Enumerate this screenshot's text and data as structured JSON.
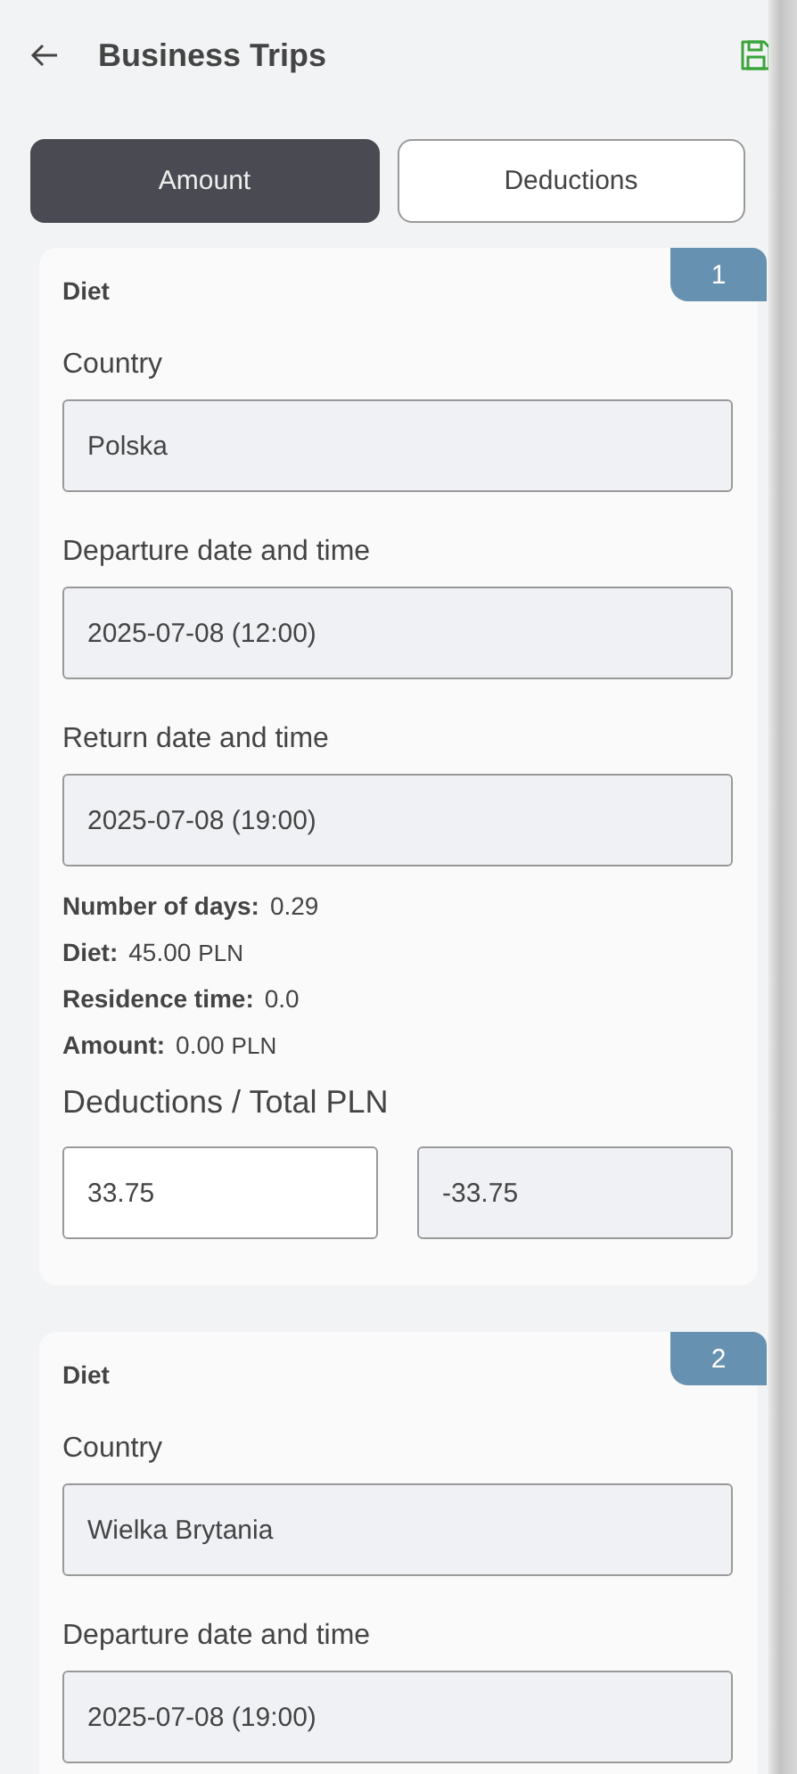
{
  "header": {
    "title": "Business Trips"
  },
  "tabs": [
    {
      "label": "Amount",
      "selected": true
    },
    {
      "label": "Deductions",
      "selected": false
    }
  ],
  "trips": [
    {
      "number": "1",
      "type": "Diet",
      "fields": [
        {
          "label": "Country",
          "value": "Polska"
        },
        {
          "label": "Departure date and time",
          "value": "2025-07-08 (12:00)"
        },
        {
          "label": "Return date and time",
          "value": "2025-07-08 (19:00)"
        }
      ],
      "stats": [
        {
          "label": "Number of days:",
          "value": "0.29"
        },
        {
          "label": "Diet:",
          "value": "45.00",
          "unit": "PLN"
        },
        {
          "label": "Residence time:",
          "value": "0.0"
        },
        {
          "label": "Amount:",
          "value": "0.00",
          "unit": "PLN"
        }
      ],
      "totals": {
        "heading": "Deductions / Total PLN",
        "inputs": [
          {
            "value": "33.75",
            "readonly": false
          },
          {
            "value": "-33.75",
            "readonly": true
          }
        ]
      }
    },
    {
      "number": "2",
      "type": "Diet",
      "fields": [
        {
          "label": "Country",
          "value": "Wielka Brytania"
        },
        {
          "label": "Departure date and time",
          "value": "2025-07-08 (19:00)"
        }
      ]
    }
  ]
}
